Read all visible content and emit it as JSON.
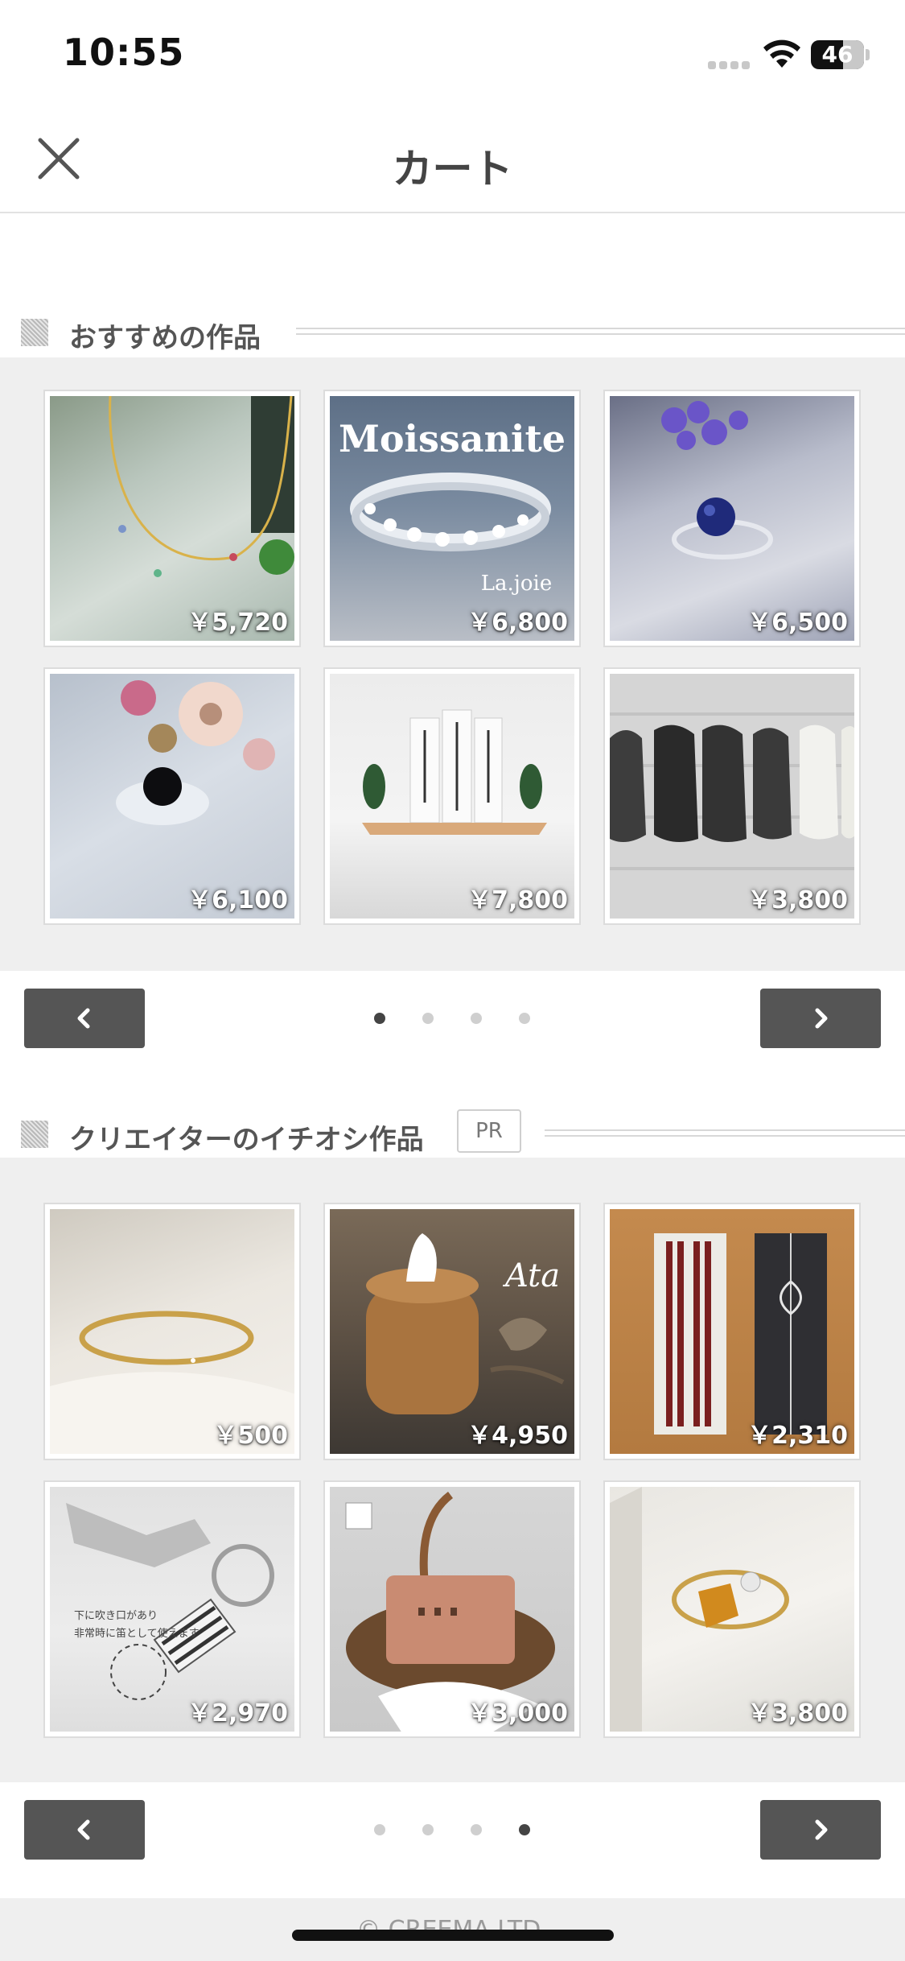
{
  "status_bar": {
    "time": "10:55",
    "battery": "46"
  },
  "nav": {
    "title": "カート"
  },
  "recommended": {
    "title": "おすすめの作品",
    "products": [
      {
        "price": "￥5,720",
        "icon": "necklace-photo"
      },
      {
        "price": "￥6,800",
        "icon": "moissanite-ring-photo",
        "overlay_title": "Moissanite",
        "overlay_brand": "La.joie"
      },
      {
        "price": "￥6,500",
        "icon": "lapis-ring-photo"
      },
      {
        "price": "￥6,100",
        "icon": "onyx-ring-photo"
      },
      {
        "price": "￥7,800",
        "icon": "shrine-shelf-photo"
      },
      {
        "price": "￥3,800",
        "icon": "leather-shoes-photo"
      }
    ],
    "pager": {
      "pages": 4,
      "active_index": 0
    }
  },
  "creator_picks": {
    "title": "クリエイターのイチオシ作品",
    "badge": "PR",
    "products": [
      {
        "price": "￥500",
        "icon": "bangle-photo"
      },
      {
        "price": "￥4,950",
        "icon": "rattan-tissue-box-photo",
        "overlay_logo": "Ata"
      },
      {
        "price": "￥2,310",
        "icon": "chopsticks-photo"
      },
      {
        "price": "￥2,970",
        "icon": "keychain-photo",
        "caption_line1": "下に吹き口があり",
        "caption_line2": "非常時に笛として使えます"
      },
      {
        "price": "￥3,000",
        "icon": "wedding-basket-photo"
      },
      {
        "price": "￥3,800",
        "icon": "citrine-ring-photo"
      }
    ],
    "pager": {
      "pages": 4,
      "active_index": 3
    }
  },
  "footer": {
    "copyright": "© CREEMA LTD."
  },
  "colors": {
    "pager_button": "#555555",
    "grid_background": "#efefef",
    "dot_active": "#444444",
    "dot_inactive": "#cfcfcf"
  }
}
